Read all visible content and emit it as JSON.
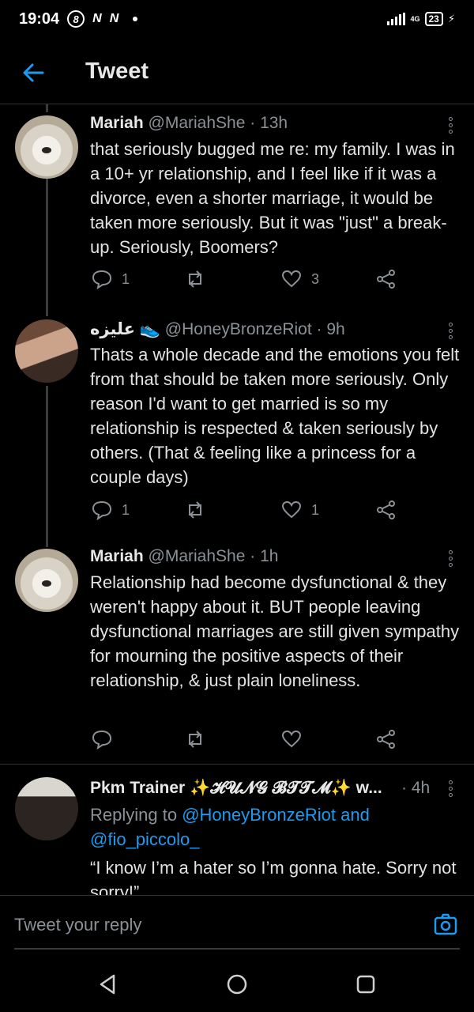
{
  "status_bar": {
    "time": "19:04",
    "icons": [
      "8-circle-icon",
      "n-icon",
      "n-icon",
      "dot-icon"
    ],
    "network": "4G",
    "battery": "23"
  },
  "header": {
    "title": "Tweet"
  },
  "tweets": [
    {
      "name": "Mariah",
      "handle": "@MariahShe",
      "time": "13h",
      "text": "that seriously bugged me re: my family. I was in a 10+ yr relationship, and I feel like if it was a divorce, even a shorter marriage, it would be taken more seriously. But it was \"just\" a break-up. Seriously, Boomers?",
      "replies": "1",
      "retweets": "",
      "likes": "3"
    },
    {
      "name": "عليزه",
      "handle": "@HoneyBronzeRiot",
      "time": "9h",
      "text": "Thats a whole decade and the emotions you felt from that should be taken more seriously. Only reason I'd want to get married is so my relationship is respected & taken seriously by others. (That & feeling like a princess for a couple days)",
      "replies": "1",
      "retweets": "",
      "likes": "1"
    },
    {
      "name": "Mariah",
      "handle": "@MariahShe",
      "time": "1h",
      "text": "Relationship had become dysfunctional & they weren't happy about it. BUT people leaving dysfunctional marriages are still given sympathy for mourning the positive aspects of their relationship, & just plain loneliness.",
      "replies": "",
      "retweets": "",
      "likes": ""
    },
    {
      "name": "Pkm Trainer ✨𝓗𝓤𝓝𝓖 𝓑𝓣𝓣𝓜✨ w...",
      "handle": "",
      "time": "4h",
      "replying_prefix": "Replying to",
      "replying_to_1": "@HoneyBronzeRiot",
      "replying_and": "and",
      "replying_to_2": "@fio_piccolo_",
      "text": "“I know I’m a hater so I’m gonna hate. Sorry not sorry!”"
    }
  ],
  "reply_bar": {
    "placeholder": "Tweet your reply"
  },
  "nav": [
    "back-triangle-icon",
    "home-circle-icon",
    "recents-square-icon"
  ]
}
